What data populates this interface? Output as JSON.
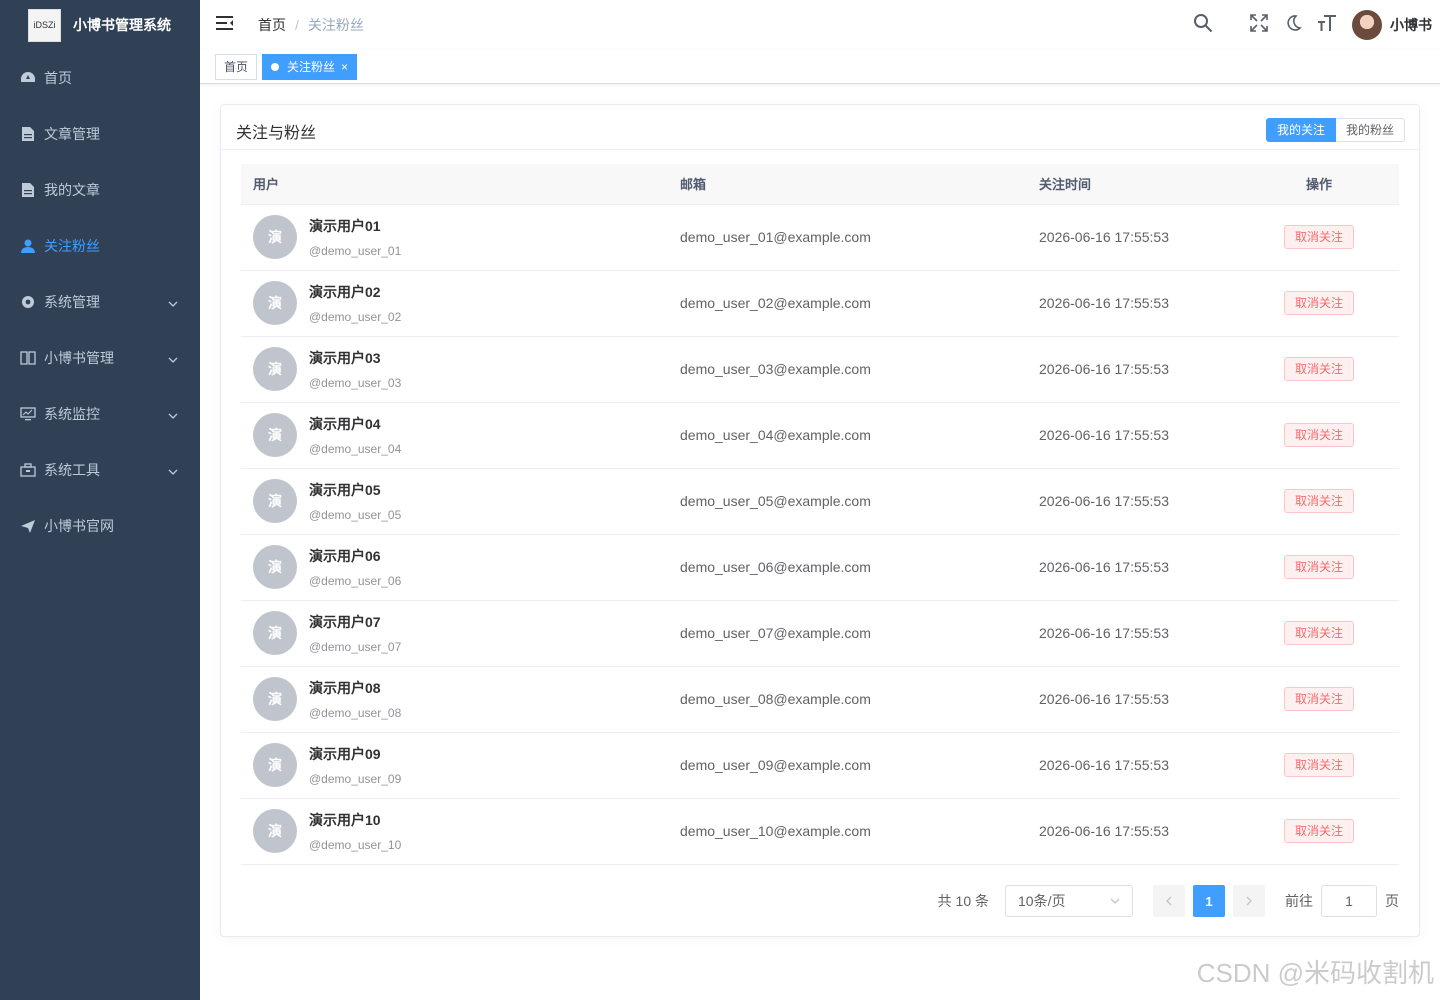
{
  "app": {
    "title": "小博书管理系统",
    "logo_text": "iDSZi"
  },
  "sidebar": {
    "items": [
      {
        "label": "首页",
        "icon": "dashboard-icon"
      },
      {
        "label": "文章管理",
        "icon": "document-icon"
      },
      {
        "label": "我的文章",
        "icon": "document-icon"
      },
      {
        "label": "关注粉丝",
        "icon": "user-icon",
        "active": true
      },
      {
        "label": "系统管理",
        "icon": "gear-icon",
        "expandable": true
      },
      {
        "label": "小博书管理",
        "icon": "book-icon",
        "expandable": true
      },
      {
        "label": "系统监控",
        "icon": "monitor-icon",
        "expandable": true
      },
      {
        "label": "系统工具",
        "icon": "toolbox-icon",
        "expandable": true
      },
      {
        "label": "小博书官网",
        "icon": "send-icon"
      }
    ]
  },
  "navbar": {
    "breadcrumb": {
      "home": "首页",
      "current": "关注粉丝"
    },
    "username": "小博书"
  },
  "tags": [
    {
      "label": "首页",
      "active": false
    },
    {
      "label": "关注粉丝",
      "active": true
    }
  ],
  "card": {
    "title": "关注与粉丝",
    "seg": {
      "following": "我的关注",
      "followers": "我的粉丝"
    }
  },
  "table": {
    "headers": {
      "user": "用户",
      "email": "邮箱",
      "time": "关注时间",
      "op": "操作"
    },
    "rows": [
      {
        "avatar": "演",
        "name": "演示用户01",
        "handle": "@demo_user_01",
        "email": "demo_user_01@example.com",
        "time": "2026-06-16 17:55:53",
        "action": "取消关注"
      },
      {
        "avatar": "演",
        "name": "演示用户02",
        "handle": "@demo_user_02",
        "email": "demo_user_02@example.com",
        "time": "2026-06-16 17:55:53",
        "action": "取消关注"
      },
      {
        "avatar": "演",
        "name": "演示用户03",
        "handle": "@demo_user_03",
        "email": "demo_user_03@example.com",
        "time": "2026-06-16 17:55:53",
        "action": "取消关注"
      },
      {
        "avatar": "演",
        "name": "演示用户04",
        "handle": "@demo_user_04",
        "email": "demo_user_04@example.com",
        "time": "2026-06-16 17:55:53",
        "action": "取消关注"
      },
      {
        "avatar": "演",
        "name": "演示用户05",
        "handle": "@demo_user_05",
        "email": "demo_user_05@example.com",
        "time": "2026-06-16 17:55:53",
        "action": "取消关注"
      },
      {
        "avatar": "演",
        "name": "演示用户06",
        "handle": "@demo_user_06",
        "email": "demo_user_06@example.com",
        "time": "2026-06-16 17:55:53",
        "action": "取消关注"
      },
      {
        "avatar": "演",
        "name": "演示用户07",
        "handle": "@demo_user_07",
        "email": "demo_user_07@example.com",
        "time": "2026-06-16 17:55:53",
        "action": "取消关注"
      },
      {
        "avatar": "演",
        "name": "演示用户08",
        "handle": "@demo_user_08",
        "email": "demo_user_08@example.com",
        "time": "2026-06-16 17:55:53",
        "action": "取消关注"
      },
      {
        "avatar": "演",
        "name": "演示用户09",
        "handle": "@demo_user_09",
        "email": "demo_user_09@example.com",
        "time": "2026-06-16 17:55:53",
        "action": "取消关注"
      },
      {
        "avatar": "演",
        "name": "演示用户10",
        "handle": "@demo_user_10",
        "email": "demo_user_10@example.com",
        "time": "2026-06-16 17:55:53",
        "action": "取消关注"
      }
    ]
  },
  "pagination": {
    "total": "共 10 条",
    "page_size": "10条/页",
    "current_page": "1",
    "jump_prefix": "前往",
    "jump_value": "1",
    "jump_suffix": "页"
  },
  "watermark": "CSDN @米码收割机",
  "colors": {
    "sidebar_bg": "#304156",
    "accent": "#409eff",
    "danger": "#f56c6c"
  }
}
